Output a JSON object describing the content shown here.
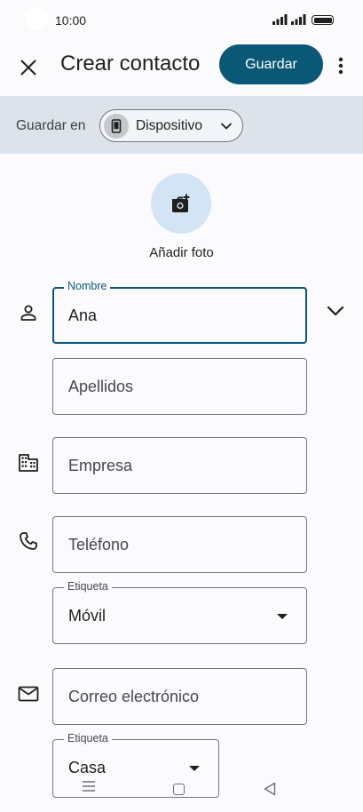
{
  "status_bar": {
    "time": "10:00",
    "icons": [
      "signal-icon",
      "signal-icon",
      "battery-icon"
    ]
  },
  "app_bar": {
    "close_icon": "close-icon",
    "title": "Crear contacto",
    "save_label": "Guardar",
    "more_icon": "more-vert-icon"
  },
  "save_in": {
    "label": "Guardar en",
    "account": "Dispositivo",
    "account_icon": "phone-icon"
  },
  "photo": {
    "icon": "add-photo-icon",
    "label": "Añadir foto"
  },
  "form": {
    "nombre": {
      "label": "Nombre",
      "value": "Ana"
    },
    "apellidos": {
      "placeholder": "Apellidos"
    },
    "empresa": {
      "placeholder": "Empresa"
    },
    "telefono": {
      "placeholder": "Teléfono"
    },
    "telefono_etiqueta": {
      "label": "Etiqueta",
      "value": "Móvil"
    },
    "correo": {
      "placeholder": "Correo electrónico"
    },
    "correo_etiqueta": {
      "label": "Etiqueta",
      "value": "Casa"
    }
  },
  "colors": {
    "accent": "#0b5876",
    "banner": "#dde3ea",
    "photo_circle": "#d3e4f4",
    "background": "#fbfbfe"
  }
}
